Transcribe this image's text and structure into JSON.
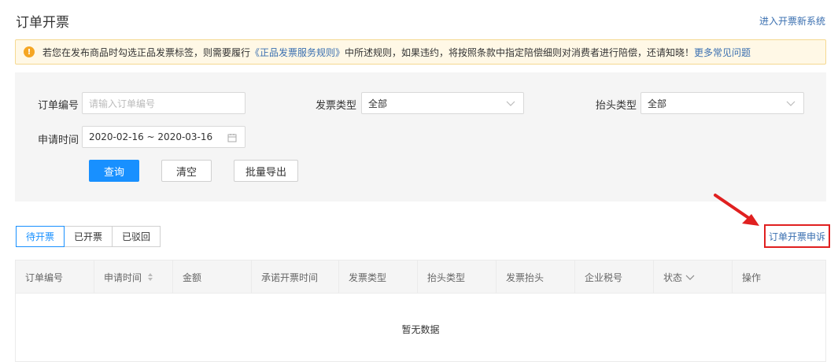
{
  "page": {
    "title": "订单开票",
    "top_link": "进入开票新系统"
  },
  "notice": {
    "icon": "warning-icon",
    "text_before": "若您在发布商品时勾选正品发票标签，则需要履行",
    "rule_link": "《正品发票服务规则》",
    "text_after": "中所述规则，如果违约，将按照条款中指定陪偿细则对消费者进行陪偿，还请知晓！",
    "faq_link": "更多常见问题",
    "colors": {
      "background": "#fff8e6",
      "border": "#f5d991",
      "icon": "#f5a623"
    }
  },
  "filters": {
    "order_no": {
      "label": "订单编号",
      "placeholder": "请输入订单编号",
      "value": ""
    },
    "invoice_type": {
      "label": "发票类型",
      "value": "全部"
    },
    "title_type": {
      "label": "抬头类型",
      "value": "全部"
    },
    "apply_time": {
      "label": "申请时间",
      "value": "2020-02-16 ~ 2020-03-16"
    },
    "buttons": {
      "query": "查询",
      "clear": "清空",
      "export": "批量导出"
    }
  },
  "tabs": [
    {
      "label": "待开票",
      "active": true
    },
    {
      "label": "已开票",
      "active": false
    },
    {
      "label": "已驳回",
      "active": false
    }
  ],
  "appeal_link": "订单开票申诉",
  "table": {
    "columns": [
      "订单编号",
      "申请时间",
      "金额",
      "承诺开票时间",
      "发票类型",
      "抬头类型",
      "发票抬头",
      "企业税号",
      "状态",
      "操作"
    ],
    "empty_text": "暂无数据"
  },
  "colors": {
    "primary": "#1890ff",
    "link": "#3a6fb0",
    "highlight": "#e02020"
  }
}
